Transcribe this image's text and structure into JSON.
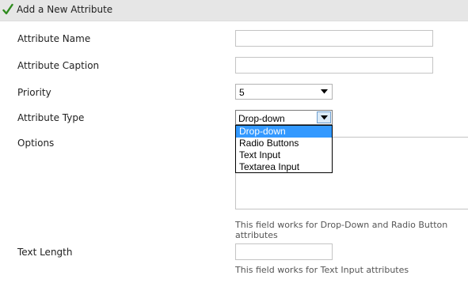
{
  "header": {
    "title": "Add a New Attribute",
    "icon": "check-icon"
  },
  "fields": {
    "attribute_name": {
      "label": "Attribute Name",
      "value": ""
    },
    "attribute_caption": {
      "label": "Attribute Caption",
      "value": ""
    },
    "priority": {
      "label": "Priority",
      "value": "5"
    },
    "attribute_type": {
      "label": "Attribute Type",
      "value": "Drop-down",
      "options": [
        "Drop-down",
        "Radio Buttons",
        "Text Input",
        "Textarea Input"
      ],
      "highlighted": "Drop-down"
    },
    "options": {
      "label": "Options",
      "value": "",
      "help": "This field works for Drop-Down and Radio Button attributes"
    },
    "text_length": {
      "label": "Text Length",
      "value": "",
      "help": "This field works for Text Input attributes"
    }
  },
  "colors": {
    "header_bg": "#e6e6e6",
    "check_green": "#2e8b1e",
    "highlight": "#3399ff"
  }
}
